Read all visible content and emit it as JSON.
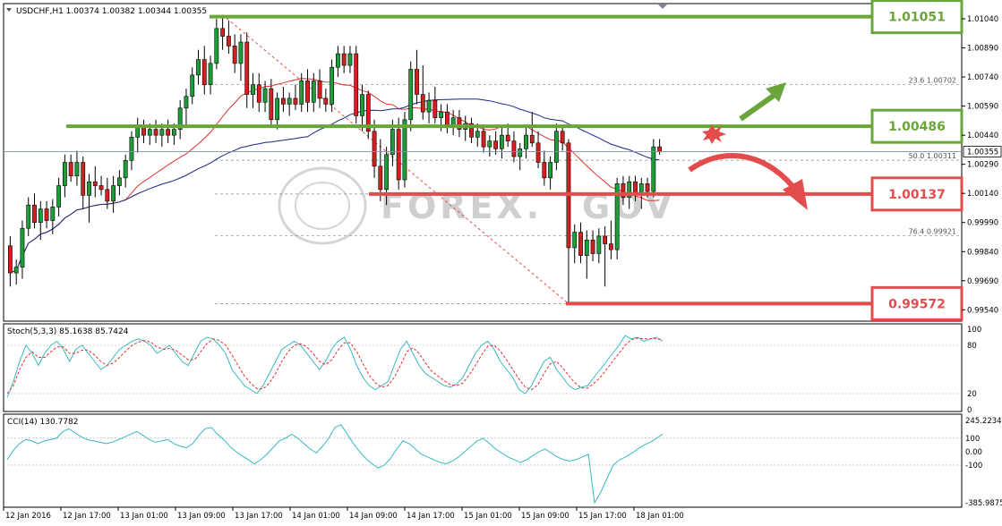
{
  "chart_data": {
    "type": "candlestick",
    "symbol_header": "USDCHF,H1  1.00374 1.00382 1.00344 1.00355",
    "watermark": "FOREX.",
    "watermark_tail": "GOV",
    "price_axis": {
      "ylim": [
        0.995,
        1.011
      ],
      "ticks": [
        "1.01040",
        "1.00890",
        "1.00740",
        "1.00590",
        "1.00440",
        "1.00290",
        "1.00140",
        "0.99990",
        "0.99840",
        "0.99690",
        "0.99540"
      ],
      "current_price": "1.00355",
      "current_value": 1.00355
    },
    "time_axis": {
      "ticks": [
        "12 Jan 2016",
        "12 Jan 17:00",
        "13 Jan 01:00",
        "13 Jan 09:00",
        "13 Jan 17:00",
        "14 Jan 01:00",
        "14 Jan 09:00",
        "14 Jan 17:00",
        "15 Jan 01:00",
        "15 Jan 09:00",
        "15 Jan 17:00",
        "18 Jan 01:00"
      ]
    },
    "levels": [
      {
        "label": "1.01051",
        "value": 1.01051,
        "color": "#6aa53a",
        "style": "green"
      },
      {
        "label": "1.00486",
        "value": 1.00486,
        "color": "#6aa53a",
        "style": "green"
      },
      {
        "label": "1.00137",
        "value": 1.00137,
        "color": "#e34c4c",
        "style": "red"
      },
      {
        "label": "0.99572",
        "value": 0.99572,
        "color": "#e34c4c",
        "style": "red"
      }
    ],
    "fibonacci": [
      {
        "label": "23.6",
        "price": "1.00702",
        "value": 1.00702
      },
      {
        "label": "50.0",
        "price": "1.00311",
        "value": 1.00311
      },
      {
        "label": "76.4",
        "price": "0.99921",
        "value": 0.99921
      }
    ],
    "fib_extra_levels": [
      1.01051,
      1.00137,
      0.99572
    ],
    "candles": [
      {
        "o": 0.9987,
        "h": 0.9992,
        "l": 0.9966,
        "c": 0.9973
      },
      {
        "o": 0.9973,
        "h": 0.998,
        "l": 0.9967,
        "c": 0.9976
      },
      {
        "o": 0.9976,
        "h": 1.0,
        "l": 0.997,
        "c": 0.9996
      },
      {
        "o": 0.9996,
        "h": 1.0012,
        "l": 0.9992,
        "c": 1.0008
      },
      {
        "o": 1.0008,
        "h": 1.0014,
        "l": 0.9996,
        "c": 0.9999
      },
      {
        "o": 0.9999,
        "h": 1.001,
        "l": 0.999,
        "c": 1.0006
      },
      {
        "o": 1.0006,
        "h": 1.001,
        "l": 0.9996,
        "c": 1.0
      },
      {
        "o": 1.0,
        "h": 1.0011,
        "l": 0.9993,
        "c": 1.0007
      },
      {
        "o": 1.0007,
        "h": 1.0022,
        "l": 1.0002,
        "c": 1.0018
      },
      {
        "o": 1.0018,
        "h": 1.0034,
        "l": 1.0012,
        "c": 1.003
      },
      {
        "o": 1.003,
        "h": 1.0034,
        "l": 1.002,
        "c": 1.0023
      },
      {
        "o": 1.0023,
        "h": 1.0036,
        "l": 1.0018,
        "c": 1.003
      },
      {
        "o": 1.003,
        "h": 1.0033,
        "l": 1.0006,
        "c": 1.0013
      },
      {
        "o": 1.0013,
        "h": 1.0024,
        "l": 0.9999,
        "c": 1.002
      },
      {
        "o": 1.002,
        "h": 1.0028,
        "l": 1.0012,
        "c": 1.0018
      },
      {
        "o": 1.0018,
        "h": 1.0023,
        "l": 1.0013,
        "c": 1.0016
      },
      {
        "o": 1.0016,
        "h": 1.0022,
        "l": 1.0006,
        "c": 1.001
      },
      {
        "o": 1.001,
        "h": 1.0023,
        "l": 1.0004,
        "c": 1.0018
      },
      {
        "o": 1.0018,
        "h": 1.0026,
        "l": 1.0013,
        "c": 1.0022
      },
      {
        "o": 1.0022,
        "h": 1.0034,
        "l": 1.0017,
        "c": 1.0031
      },
      {
        "o": 1.0031,
        "h": 1.0046,
        "l": 1.0026,
        "c": 1.0043
      },
      {
        "o": 1.0043,
        "h": 1.0053,
        "l": 1.0035,
        "c": 1.0048
      },
      {
        "o": 1.0048,
        "h": 1.0052,
        "l": 1.004,
        "c": 1.0044
      },
      {
        "o": 1.0044,
        "h": 1.005,
        "l": 1.0039,
        "c": 1.0047
      },
      {
        "o": 1.0047,
        "h": 1.0052,
        "l": 1.004,
        "c": 1.0044
      },
      {
        "o": 1.0044,
        "h": 1.005,
        "l": 1.0038,
        "c": 1.0047
      },
      {
        "o": 1.0047,
        "h": 1.0052,
        "l": 1.004,
        "c": 1.0044
      },
      {
        "o": 1.0044,
        "h": 1.005,
        "l": 1.0039,
        "c": 1.0047
      },
      {
        "o": 1.0047,
        "h": 1.0062,
        "l": 1.0042,
        "c": 1.0058
      },
      {
        "o": 1.0058,
        "h": 1.0068,
        "l": 1.0048,
        "c": 1.0064
      },
      {
        "o": 1.0064,
        "h": 1.0079,
        "l": 1.006,
        "c": 1.0075
      },
      {
        "o": 1.0075,
        "h": 1.0088,
        "l": 1.007,
        "c": 1.0083
      },
      {
        "o": 1.0083,
        "h": 1.009,
        "l": 1.0065,
        "c": 1.007
      },
      {
        "o": 1.007,
        "h": 1.0085,
        "l": 1.0065,
        "c": 1.0081
      },
      {
        "o": 1.0081,
        "h": 1.0104,
        "l": 1.0078,
        "c": 1.0099
      },
      {
        "o": 1.0099,
        "h": 1.0106,
        "l": 1.0088,
        "c": 1.0095
      },
      {
        "o": 1.0095,
        "h": 1.0103,
        "l": 1.0086,
        "c": 1.009
      },
      {
        "o": 1.009,
        "h": 1.0096,
        "l": 1.0076,
        "c": 1.0081
      },
      {
        "o": 1.0081,
        "h": 1.0096,
        "l": 1.0072,
        "c": 1.0092
      },
      {
        "o": 1.0092,
        "h": 1.0097,
        "l": 1.0058,
        "c": 1.0065
      },
      {
        "o": 1.0065,
        "h": 1.0076,
        "l": 1.0058,
        "c": 1.007
      },
      {
        "o": 1.007,
        "h": 1.0076,
        "l": 1.0056,
        "c": 1.0061
      },
      {
        "o": 1.0061,
        "h": 1.0072,
        "l": 1.0056,
        "c": 1.0068
      },
      {
        "o": 1.0068,
        "h": 1.0073,
        "l": 1.0048,
        "c": 1.0052
      },
      {
        "o": 1.0052,
        "h": 1.0066,
        "l": 1.0047,
        "c": 1.0063
      },
      {
        "o": 1.0063,
        "h": 1.0069,
        "l": 1.0056,
        "c": 1.006
      },
      {
        "o": 1.006,
        "h": 1.0066,
        "l": 1.0054,
        "c": 1.0063
      },
      {
        "o": 1.0063,
        "h": 1.007,
        "l": 1.0057,
        "c": 1.006
      },
      {
        "o": 1.006,
        "h": 1.0076,
        "l": 1.0056,
        "c": 1.0072
      },
      {
        "o": 1.0072,
        "h": 1.0078,
        "l": 1.0056,
        "c": 1.0061
      },
      {
        "o": 1.0061,
        "h": 1.0076,
        "l": 1.0056,
        "c": 1.0072
      },
      {
        "o": 1.0072,
        "h": 1.0078,
        "l": 1.0058,
        "c": 1.0063
      },
      {
        "o": 1.0063,
        "h": 1.0068,
        "l": 1.0056,
        "c": 1.006
      },
      {
        "o": 1.006,
        "h": 1.0083,
        "l": 1.0056,
        "c": 1.0079
      },
      {
        "o": 1.0079,
        "h": 1.009,
        "l": 1.0074,
        "c": 1.0086
      },
      {
        "o": 1.0086,
        "h": 1.009,
        "l": 1.0076,
        "c": 1.008
      },
      {
        "o": 1.008,
        "h": 1.009,
        "l": 1.0076,
        "c": 1.0086
      },
      {
        "o": 1.0086,
        "h": 1.009,
        "l": 1.005,
        "c": 1.0054
      },
      {
        "o": 1.0054,
        "h": 1.007,
        "l": 1.0046,
        "c": 1.0065
      },
      {
        "o": 1.0065,
        "h": 1.0067,
        "l": 1.0042,
        "c": 1.0046
      },
      {
        "o": 1.0046,
        "h": 1.0052,
        "l": 1.0022,
        "c": 1.0028
      },
      {
        "o": 1.0028,
        "h": 1.0042,
        "l": 1.001,
        "c": 1.0016
      },
      {
        "o": 1.0016,
        "h": 1.0038,
        "l": 1.0008,
        "c": 1.0034
      },
      {
        "o": 1.0034,
        "h": 1.0052,
        "l": 1.0028,
        "c": 1.0047
      },
      {
        "o": 1.0047,
        "h": 1.0053,
        "l": 1.0016,
        "c": 1.0021
      },
      {
        "o": 1.0021,
        "h": 1.0056,
        "l": 1.0017,
        "c": 1.0052
      },
      {
        "o": 1.0052,
        "h": 1.0082,
        "l": 1.0046,
        "c": 1.0078
      },
      {
        "o": 1.0078,
        "h": 1.0088,
        "l": 1.006,
        "c": 1.0065
      },
      {
        "o": 1.0065,
        "h": 1.008,
        "l": 1.0052,
        "c": 1.0056
      },
      {
        "o": 1.0056,
        "h": 1.0066,
        "l": 1.005,
        "c": 1.0062
      },
      {
        "o": 1.0062,
        "h": 1.0069,
        "l": 1.005,
        "c": 1.0053
      },
      {
        "o": 1.0053,
        "h": 1.006,
        "l": 1.0046,
        "c": 1.0056
      },
      {
        "o": 1.0056,
        "h": 1.006,
        "l": 1.0045,
        "c": 1.0049
      },
      {
        "o": 1.0049,
        "h": 1.0057,
        "l": 1.0044,
        "c": 1.0053
      },
      {
        "o": 1.0053,
        "h": 1.0057,
        "l": 1.0043,
        "c": 1.0047
      },
      {
        "o": 1.0047,
        "h": 1.0054,
        "l": 1.0041,
        "c": 1.005
      },
      {
        "o": 1.005,
        "h": 1.0053,
        "l": 1.004,
        "c": 1.0043
      },
      {
        "o": 1.0043,
        "h": 1.005,
        "l": 1.0038,
        "c": 1.0046
      },
      {
        "o": 1.0046,
        "h": 1.0048,
        "l": 1.0035,
        "c": 1.0038
      },
      {
        "o": 1.0038,
        "h": 1.0044,
        "l": 1.0033,
        "c": 1.0041
      },
      {
        "o": 1.0041,
        "h": 1.0046,
        "l": 1.0034,
        "c": 1.0037
      },
      {
        "o": 1.0037,
        "h": 1.0048,
        "l": 1.0032,
        "c": 1.0044
      },
      {
        "o": 1.0044,
        "h": 1.005,
        "l": 1.0038,
        "c": 1.0041
      },
      {
        "o": 1.0041,
        "h": 1.0046,
        "l": 1.003,
        "c": 1.0033
      },
      {
        "o": 1.0033,
        "h": 1.004,
        "l": 1.0026,
        "c": 1.0037
      },
      {
        "o": 1.0037,
        "h": 1.0048,
        "l": 1.0032,
        "c": 1.0044
      },
      {
        "o": 1.0044,
        "h": 1.0056,
        "l": 1.0038,
        "c": 1.004
      },
      {
        "o": 1.004,
        "h": 1.0046,
        "l": 1.0027,
        "c": 1.003
      },
      {
        "o": 1.003,
        "h": 1.0036,
        "l": 1.0018,
        "c": 1.0022
      },
      {
        "o": 1.0022,
        "h": 1.0033,
        "l": 1.0016,
        "c": 1.003
      },
      {
        "o": 1.003,
        "h": 1.005,
        "l": 1.0026,
        "c": 1.0046
      },
      {
        "o": 1.0046,
        "h": 1.0048,
        "l": 1.0036,
        "c": 1.004
      },
      {
        "o": 1.004,
        "h": 1.0042,
        "l": 0.99572,
        "c": 0.9986
      },
      {
        "o": 0.9986,
        "h": 0.9998,
        "l": 0.9978,
        "c": 0.9994
      },
      {
        "o": 0.9994,
        "h": 0.9999,
        "l": 0.9978,
        "c": 0.9982
      },
      {
        "o": 0.9982,
        "h": 0.9995,
        "l": 0.997,
        "c": 0.999
      },
      {
        "o": 0.999,
        "h": 0.9995,
        "l": 0.9979,
        "c": 0.9983
      },
      {
        "o": 0.9983,
        "h": 0.9996,
        "l": 0.9978,
        "c": 0.9992
      },
      {
        "o": 0.9992,
        "h": 0.9997,
        "l": 0.9966,
        "c": 0.9988
      },
      {
        "o": 0.9988,
        "h": 1.0,
        "l": 0.998,
        "c": 0.9985
      },
      {
        "o": 0.9985,
        "h": 1.0022,
        "l": 0.998,
        "c": 1.0019
      },
      {
        "o": 1.0019,
        "h": 1.0023,
        "l": 1.0008,
        "c": 1.0012
      },
      {
        "o": 1.0012,
        "h": 1.0023,
        "l": 1.0006,
        "c": 1.002
      },
      {
        "o": 1.002,
        "h": 1.0023,
        "l": 1.001,
        "c": 1.0014
      },
      {
        "o": 1.0014,
        "h": 1.0022,
        "l": 1.0006,
        "c": 1.0019
      },
      {
        "o": 1.0019,
        "h": 1.0022,
        "l": 1.0012,
        "c": 1.0015
      },
      {
        "o": 1.0015,
        "h": 1.0042,
        "l": 1.0012,
        "c": 1.0038
      },
      {
        "o": 1.0038,
        "h": 1.0042,
        "l": 1.0034,
        "c": 1.00355
      }
    ],
    "stochastic": {
      "label": "Stoch(5,3,3) 85.1638 85.7424",
      "ylim": [
        0,
        100
      ],
      "ticks": [
        "100",
        "80",
        "20",
        "0"
      ],
      "main": [
        15,
        35,
        60,
        80,
        70,
        55,
        70,
        80,
        85,
        75,
        60,
        75,
        80,
        70,
        60,
        50,
        55,
        65,
        75,
        80,
        85,
        88,
        85,
        80,
        70,
        75,
        80,
        70,
        60,
        55,
        70,
        85,
        90,
        88,
        80,
        70,
        50,
        40,
        30,
        25,
        20,
        30,
        45,
        60,
        75,
        80,
        85,
        80,
        70,
        60,
        50,
        60,
        75,
        85,
        90,
        75,
        55,
        40,
        30,
        25,
        30,
        35,
        55,
        75,
        85,
        70,
        55,
        45,
        40,
        35,
        30,
        28,
        32,
        40,
        55,
        70,
        80,
        85,
        75,
        60,
        50,
        40,
        25,
        20,
        30,
        45,
        60,
        65,
        50,
        40,
        30,
        25,
        28,
        30,
        40,
        50,
        60,
        70,
        80,
        92,
        88,
        90,
        85,
        88,
        90,
        85
      ],
      "signal": [
        20,
        30,
        50,
        65,
        72,
        65,
        65,
        72,
        78,
        78,
        70,
        70,
        74,
        74,
        68,
        60,
        55,
        58,
        65,
        73,
        80,
        84,
        86,
        84,
        78,
        75,
        76,
        74,
        68,
        62,
        62,
        72,
        82,
        88,
        86,
        80,
        68,
        55,
        42,
        33,
        26,
        26,
        33,
        45,
        60,
        72,
        80,
        82,
        78,
        70,
        60,
        56,
        62,
        74,
        83,
        83,
        72,
        57,
        43,
        33,
        28,
        30,
        40,
        55,
        72,
        77,
        70,
        58,
        48,
        42,
        36,
        31,
        30,
        33,
        43,
        55,
        68,
        79,
        80,
        73,
        62,
        50,
        38,
        28,
        25,
        31,
        45,
        57,
        60,
        52,
        42,
        33,
        27,
        27,
        33,
        40,
        50,
        60,
        70,
        80,
        87,
        89,
        88,
        88,
        88,
        87
      ]
    },
    "cci": {
      "label": "CCI(14) 130.7782",
      "ylim": [
        -385.9875,
        245.2234
      ],
      "ticks": [
        "245.2234",
        "100",
        "0.00",
        "-100",
        "-385.9875"
      ],
      "values": [
        -60,
        10,
        60,
        90,
        80,
        60,
        80,
        90,
        100,
        150,
        170,
        140,
        110,
        90,
        80,
        70,
        60,
        70,
        90,
        110,
        130,
        150,
        120,
        90,
        70,
        80,
        90,
        60,
        40,
        30,
        60,
        120,
        170,
        180,
        130,
        90,
        40,
        0,
        -30,
        -60,
        -90,
        -60,
        -20,
        30,
        80,
        100,
        130,
        100,
        60,
        20,
        -10,
        40,
        100,
        180,
        200,
        130,
        60,
        0,
        -50,
        -90,
        -120,
        -100,
        -50,
        20,
        80,
        60,
        20,
        -20,
        -40,
        -60,
        -80,
        -90,
        -70,
        -40,
        0,
        40,
        80,
        100,
        60,
        20,
        -10,
        -40,
        -60,
        -80,
        -60,
        -30,
        0,
        20,
        -10,
        -40,
        -60,
        -70,
        -60,
        -40,
        -20,
        -380,
        -300,
        -200,
        -100,
        -60,
        -40,
        -10,
        20,
        50,
        70,
        100,
        130
      ]
    },
    "moving_averages": [
      {
        "name": "",
        "period": 20,
        "color": "#e03030"
      },
      {
        "name": "",
        "period": 50,
        "color": "#1a237e"
      }
    ]
  }
}
